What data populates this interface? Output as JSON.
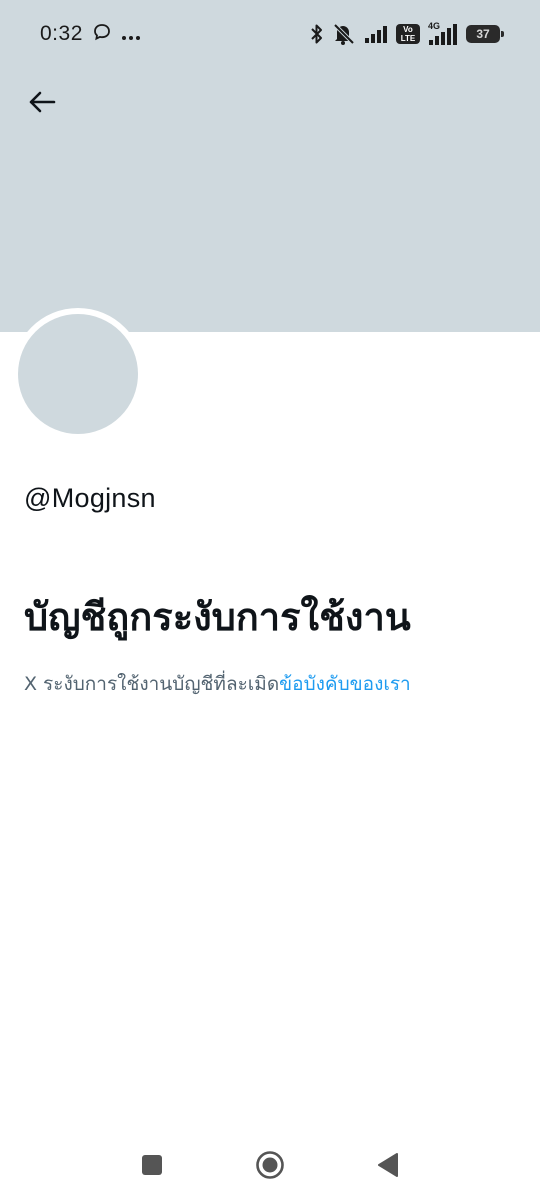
{
  "status_bar": {
    "time": "0:32",
    "battery": "37",
    "volte_top": "Vo",
    "volte_bottom": "LTE",
    "network": "4G",
    "icons": [
      "chat-bubble-icon",
      "more-dots-icon",
      "bluetooth-icon",
      "bell-muted-icon",
      "signal-icon",
      "volte-icon",
      "signal-4g-icon",
      "battery-icon"
    ]
  },
  "header": {
    "back_icon": "arrow-left-icon",
    "banner_color": "#cfd9de"
  },
  "profile": {
    "handle": "@Mogjnsn",
    "avatar_color": "#cfd9de"
  },
  "suspension": {
    "title": "บัญชีถูกระงับการใช้งาน",
    "description": "X ระงับการใช้งานบัญชีที่ละเมิด",
    "link_text": "ข้อบังคับของเรา",
    "link_color": "#1d9bf0",
    "text_color": "#536471"
  },
  "nav_bar": {
    "items": [
      "recents-square-icon",
      "home-circle-icon",
      "back-triangle-icon"
    ]
  }
}
